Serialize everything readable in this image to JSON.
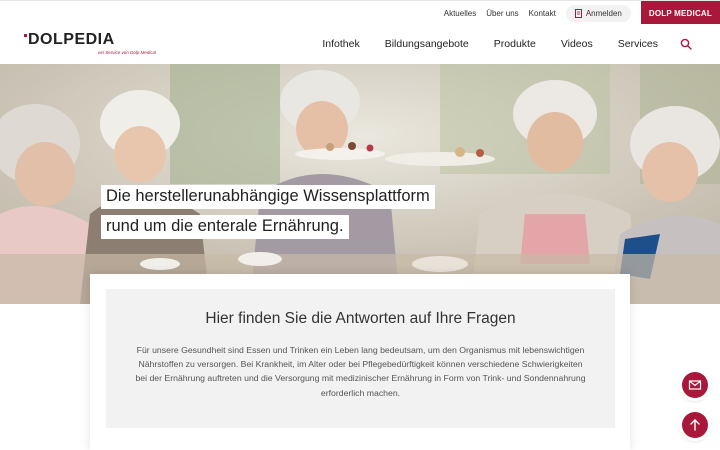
{
  "topbar": {
    "links": [
      "Aktuelles",
      "Über uns",
      "Kontakt"
    ],
    "login_label": "Anmelden",
    "brand_button": "DOLP MEDICAL"
  },
  "header": {
    "logo_text": "DOLPEDIA",
    "logo_tagline": "ein Service von Dolp Medical",
    "nav": [
      "Infothek",
      "Bildungsangebote",
      "Produkte",
      "Videos",
      "Services"
    ]
  },
  "hero": {
    "line1": "Die herstellerunabhängige Wissensplattform",
    "line2": "rund um die enterale Ernährung."
  },
  "intro": {
    "heading": "Hier finden Sie die Antworten auf Ihre Fragen",
    "text": "Für unsere Gesundheit sind Essen und Trinken ein Leben lang bedeutsam, um den Organismus mit lebenswichtigen Nährstoffen zu versorgen. Bei Krankheit, im Alter oder bei Pflegebedürftigkeit können verschiedene Schwierigkeiten bei der Ernährung auftreten und die Versorgung mit medizinischer Ernährung in Form von Trink- und Sondennahrung erforderlich machen."
  },
  "colors": {
    "brand": "#a8183b",
    "card_bg": "#f2f2f2"
  },
  "icons": {
    "login": "document-icon",
    "search": "search-icon",
    "contact": "mail-icon",
    "back_to_top": "arrow-up-icon"
  }
}
